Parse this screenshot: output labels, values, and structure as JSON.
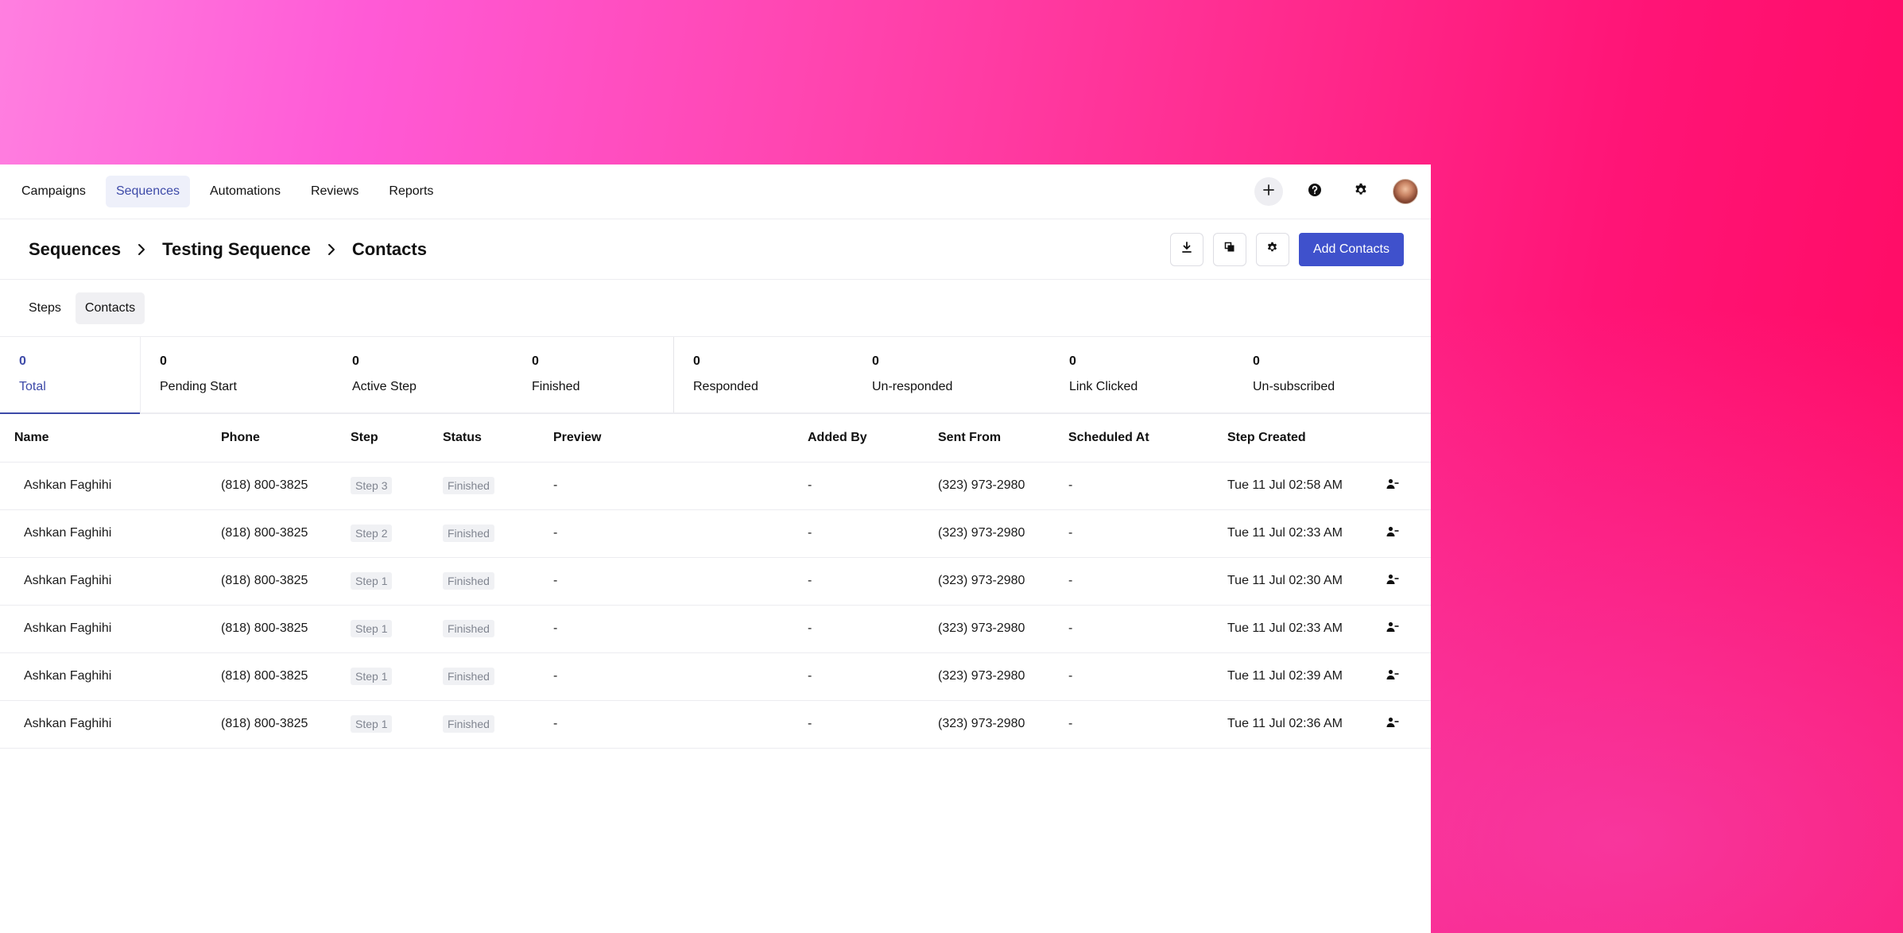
{
  "topnav": {
    "items": [
      {
        "label": "Campaigns",
        "active": false
      },
      {
        "label": "Sequences",
        "active": true
      },
      {
        "label": "Automations",
        "active": false
      },
      {
        "label": "Reviews",
        "active": false
      },
      {
        "label": "Reports",
        "active": false
      }
    ],
    "icons": [
      "plus-icon",
      "help-icon",
      "gear-icon",
      "avatar"
    ]
  },
  "breadcrumb": {
    "items": [
      "Sequences",
      "Testing Sequence",
      "Contacts"
    ]
  },
  "header_actions": {
    "download_icon": "download-icon",
    "duplicate_icon": "duplicate-icon",
    "settings_icon": "gear-icon",
    "add_contacts_label": "Add Contacts"
  },
  "subtabs": [
    {
      "label": "Steps",
      "active": false
    },
    {
      "label": "Contacts",
      "active": true
    }
  ],
  "stats": [
    {
      "value": "0",
      "label": "Total",
      "active": true
    },
    {
      "value": "0",
      "label": "Pending Start"
    },
    {
      "value": "0",
      "label": "Active Step"
    },
    {
      "value": "0",
      "label": "Finished"
    },
    {
      "value": "0",
      "label": "Responded"
    },
    {
      "value": "0",
      "label": "Un-responded"
    },
    {
      "value": "0",
      "label": "Link Clicked"
    },
    {
      "value": "0",
      "label": "Un-subscribed"
    }
  ],
  "table": {
    "columns": [
      "Name",
      "Phone",
      "Step",
      "Status",
      "Preview",
      "Added By",
      "Sent From",
      "Scheduled At",
      "Step Created",
      ""
    ],
    "rows": [
      {
        "name": "Ashkan Faghihi",
        "phone": "(818) 800-3825",
        "step": "Step 3",
        "status": "Finished",
        "preview": "-",
        "added_by": "-",
        "sent_from": "(323) 973-2980",
        "scheduled_at": "-",
        "step_created": "Tue 11 Jul 02:58 AM",
        "action_icon": "remove-user-icon"
      },
      {
        "name": "Ashkan Faghihi",
        "phone": "(818) 800-3825",
        "step": "Step 2",
        "status": "Finished",
        "preview": "-",
        "added_by": "-",
        "sent_from": "(323) 973-2980",
        "scheduled_at": "-",
        "step_created": "Tue 11 Jul 02:33 AM",
        "action_icon": "remove-user-icon"
      },
      {
        "name": "Ashkan Faghihi",
        "phone": "(818) 800-3825",
        "step": "Step 1",
        "status": "Finished",
        "preview": "-",
        "added_by": "-",
        "sent_from": "(323) 973-2980",
        "scheduled_at": "-",
        "step_created": "Tue 11 Jul 02:30 AM",
        "action_icon": "remove-user-icon"
      },
      {
        "name": "Ashkan Faghihi",
        "phone": "(818) 800-3825",
        "step": "Step 1",
        "status": "Finished",
        "preview": "-",
        "added_by": "-",
        "sent_from": "(323) 973-2980",
        "scheduled_at": "-",
        "step_created": "Tue 11 Jul 02:33 AM",
        "action_icon": "remove-user-icon"
      },
      {
        "name": "Ashkan Faghihi",
        "phone": "(818) 800-3825",
        "step": "Step 1",
        "status": "Finished",
        "preview": "-",
        "added_by": "-",
        "sent_from": "(323) 973-2980",
        "scheduled_at": "-",
        "step_created": "Tue 11 Jul 02:39 AM",
        "action_icon": "remove-user-icon"
      },
      {
        "name": "Ashkan Faghihi",
        "phone": "(818) 800-3825",
        "step": "Step 1",
        "status": "Finished",
        "preview": "-",
        "added_by": "-",
        "sent_from": "(323) 973-2980",
        "scheduled_at": "-",
        "step_created": "Tue 11 Jul 02:36 AM",
        "action_icon": "remove-user-icon"
      }
    ]
  },
  "colors": {
    "accent": "#3f51cc",
    "active_text": "#3d4aa8",
    "active_nav_bg": "#eef0fa",
    "pill_bg": "#f0f1f4",
    "background_gradient_start": "#ff7fe0",
    "background_gradient_end": "#ff0a62"
  }
}
